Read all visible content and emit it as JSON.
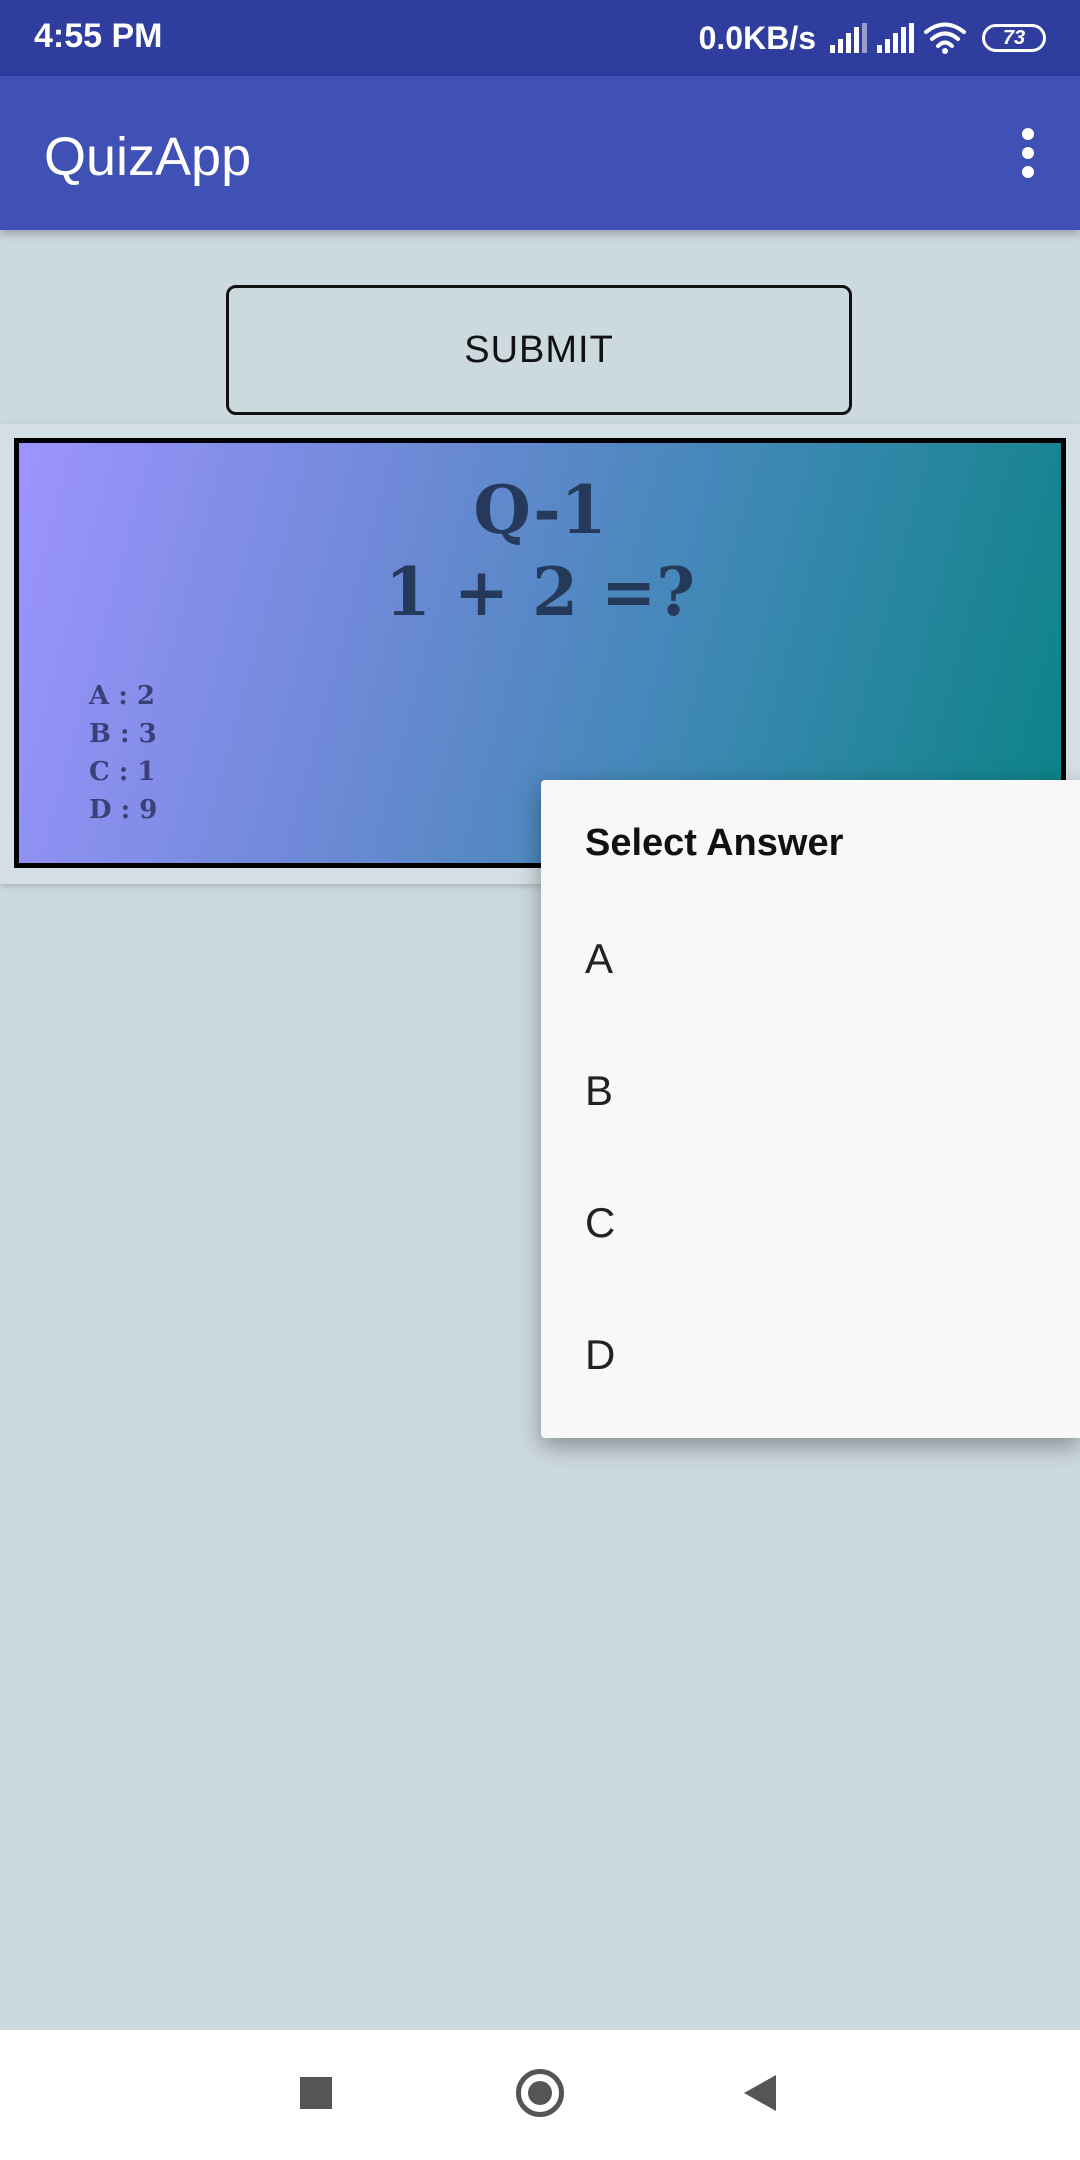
{
  "status_bar": {
    "time": "4:55 PM",
    "net_speed": "0.0KB/s",
    "battery": "73"
  },
  "app_bar": {
    "title": "QuizApp",
    "overflow_icon": "more-vert-icon"
  },
  "submit_label": "SUBMIT",
  "question": {
    "number": "Q-1",
    "text": "1 + 2 =?",
    "options": [
      "A : 2",
      "B : 3",
      "C : 1",
      "D : 9"
    ]
  },
  "answer_popup": {
    "title": "Select Answer",
    "items": [
      "A",
      "B",
      "C",
      "D"
    ]
  },
  "nav_bar": {
    "icons": [
      "recent-apps-icon",
      "home-icon",
      "back-icon"
    ]
  },
  "colors": {
    "status_bar": "#2f3d9e",
    "app_bar": "#3f51b5",
    "background": "#ccd9df",
    "card_text": "#25395a"
  }
}
